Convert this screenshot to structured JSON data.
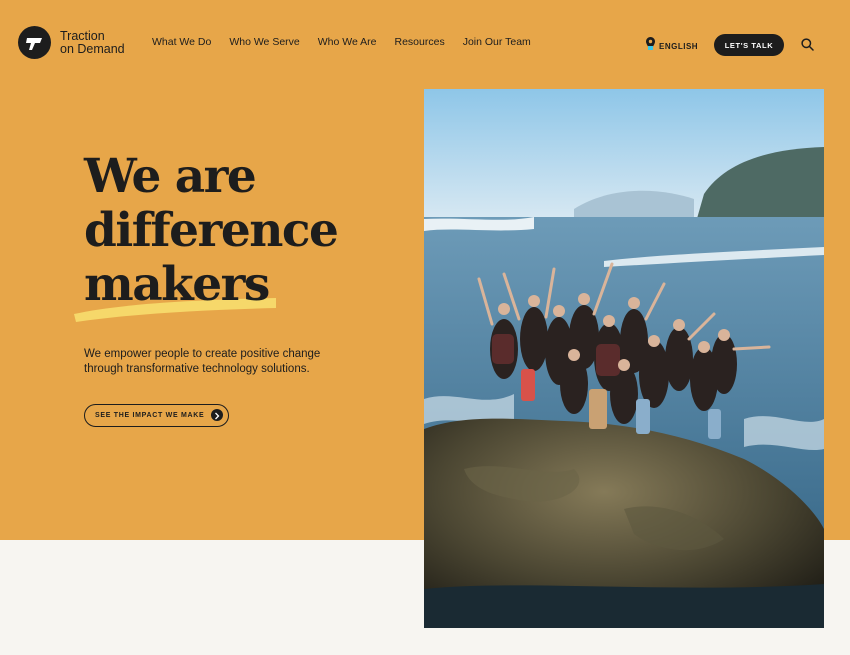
{
  "brand": {
    "line1": "Traction",
    "line2": "on Demand"
  },
  "nav": {
    "items": [
      {
        "label": "What We Do"
      },
      {
        "label": "Who We Serve"
      },
      {
        "label": "Who We Are"
      },
      {
        "label": "Resources"
      },
      {
        "label": "Join Our Team"
      }
    ]
  },
  "header": {
    "language": "ENGLISH",
    "cta": "LET'S TALK",
    "search_icon": "search-icon",
    "location_icon": "location-pin-icon"
  },
  "hero": {
    "headline": [
      "We are",
      "difference",
      "makers"
    ],
    "subtext": "We empower people to create positive change through transformative technology solutions.",
    "button": "SEE THE IMPACT WE MAKE",
    "button_icon": "arrow-right-icon"
  },
  "colors": {
    "hero_bg": "#e7a649",
    "dark": "#1d1d1d",
    "highlight": "#f6d86a",
    "lower_bg": "#f7f5f1",
    "pin": "#3cc6e6"
  }
}
